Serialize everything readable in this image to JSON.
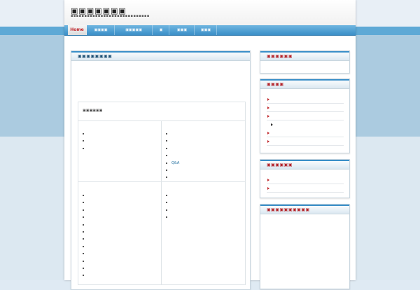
{
  "site": {
    "title": "▣▣▣▣▣▣▣",
    "tagline": "▪▪▪▪▪▪▪▪▪▪▪▪▪▪▪▪▪▪▪▪▪▪▪▪▪▪▪▪▪"
  },
  "nav": {
    "items": [
      {
        "label": "Home"
      },
      {
        "label": "▣▣▣▣"
      },
      {
        "label": "▣▣▣▣▣"
      },
      {
        "label": "▣"
      },
      {
        "label": "▣▣▣"
      },
      {
        "label": "▣▣▣"
      }
    ]
  },
  "main": {
    "box_title": "▣▣▣▣▣▣▣▣",
    "table": {
      "header": "▣▣▣▣▣▣",
      "cells": [
        {
          "items": [
            "",
            "",
            ""
          ]
        },
        {
          "items": [
            "",
            "",
            "",
            "",
            "Q&A",
            "",
            ""
          ]
        },
        {
          "items": [
            "",
            "",
            "",
            "",
            "",
            "",
            "",
            "",
            "",
            "",
            "",
            ""
          ]
        },
        {
          "items": [
            "",
            "",
            "",
            ""
          ]
        }
      ]
    }
  },
  "sidebar": {
    "box1": {
      "title": "▣▣▣▣▣▣"
    },
    "box2": {
      "title": "▣▣▣▣",
      "items": [
        "",
        "",
        "",
        "",
        "",
        ""
      ]
    },
    "box3": {
      "title": "▣▣▣▣▣▣",
      "items": [
        "",
        ""
      ]
    },
    "box4": {
      "title": "▣▣▣▣▣▣▣▣▣▣"
    }
  },
  "colors": {
    "accent_blue": "#3a8fc8",
    "accent_red": "#c0262b",
    "link": "#1a6a9c"
  }
}
